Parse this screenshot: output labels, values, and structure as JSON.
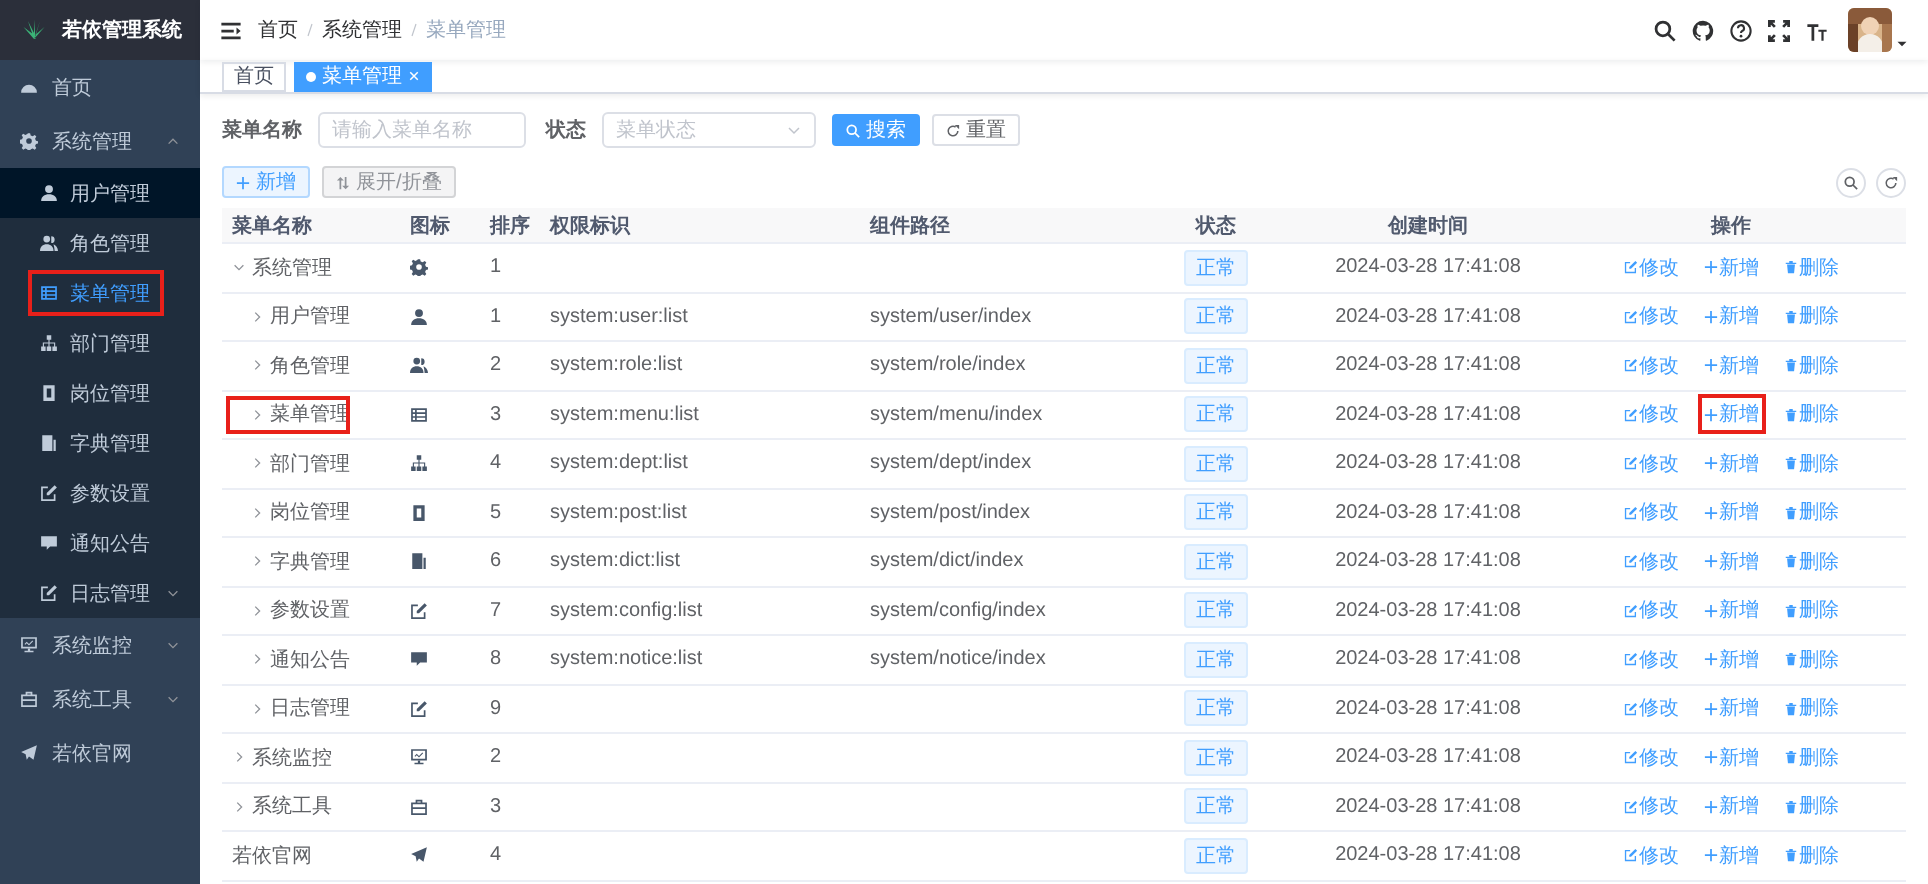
{
  "app": {
    "title": "若依管理系统"
  },
  "sidebar": {
    "items": [
      {
        "label": "首页",
        "kind": "item",
        "selected": false
      },
      {
        "label": "系统管理",
        "kind": "group",
        "selected": false,
        "expanded": true,
        "children": [
          {
            "label": "用户管理",
            "kind": "item",
            "selected": false,
            "hovered": true
          },
          {
            "label": "角色管理",
            "kind": "item",
            "selected": false
          },
          {
            "label": "菜单管理",
            "kind": "item",
            "selected": true,
            "highlighted": true
          },
          {
            "label": "部门管理",
            "kind": "item",
            "selected": false
          },
          {
            "label": "岗位管理",
            "kind": "item",
            "selected": false
          },
          {
            "label": "字典管理",
            "kind": "item",
            "selected": false
          },
          {
            "label": "参数设置",
            "kind": "item",
            "selected": false
          },
          {
            "label": "通知公告",
            "kind": "item",
            "selected": false
          },
          {
            "label": "日志管理",
            "kind": "group",
            "selected": false,
            "expanded": false
          }
        ]
      },
      {
        "label": "系统监控",
        "kind": "group",
        "selected": false,
        "expanded": false
      },
      {
        "label": "系统工具",
        "kind": "group",
        "selected": false,
        "expanded": false
      },
      {
        "label": "若依官网",
        "kind": "item",
        "selected": false
      }
    ]
  },
  "navbar": {
    "breadcrumb": [
      "首页",
      "系统管理",
      "菜单管理"
    ]
  },
  "tags": [
    {
      "label": "首页",
      "selected": false
    },
    {
      "label": "菜单管理",
      "selected": true
    }
  ],
  "search": {
    "fields": [
      {
        "label": "菜单名称",
        "kind": "input",
        "placeholder": "请输入菜单名称"
      },
      {
        "label": "状态",
        "kind": "select",
        "placeholder": "菜单状态"
      }
    ],
    "buttons": [
      {
        "label": "搜索",
        "kind": "primary"
      },
      {
        "label": "重置",
        "kind": "default"
      }
    ]
  },
  "toolbar": {
    "buttons": [
      {
        "label": "新增",
        "kind": "plain"
      },
      {
        "label": "展开/折叠",
        "kind": "info"
      }
    ]
  },
  "table": {
    "columns": [
      "菜单名称",
      "图标",
      "排序",
      "权限标识",
      "组件路径",
      "状态",
      "创建时间",
      "操作"
    ],
    "rows": [
      {
        "name": "系统管理",
        "kind": "dir",
        "expanded": true,
        "sort": "1",
        "status": "正常",
        "created": "2024-03-28 17:41:08",
        "actions": [
          {
            "label": "修改",
            "highlighted": false
          },
          {
            "label": "新增",
            "highlighted": false
          },
          {
            "label": "删除",
            "highlighted": false
          }
        ],
        "children": [
          {
            "name": "用户管理",
            "kind": "dir",
            "expanded": false,
            "sort": "1",
            "perms": "system:user:list",
            "component": "system/user/index",
            "status": "正常",
            "created": "2024-03-28 17:41:08",
            "actions": [
              {
                "label": "修改",
                "highlighted": false
              },
              {
                "label": "新增",
                "highlighted": false
              },
              {
                "label": "删除",
                "highlighted": false
              }
            ]
          },
          {
            "name": "角色管理",
            "kind": "dir",
            "expanded": false,
            "sort": "2",
            "perms": "system:role:list",
            "component": "system/role/index",
            "status": "正常",
            "created": "2024-03-28 17:41:08",
            "actions": [
              {
                "label": "修改",
                "highlighted": false
              },
              {
                "label": "新增",
                "highlighted": false
              },
              {
                "label": "删除",
                "highlighted": false
              }
            ]
          },
          {
            "name": "菜单管理",
            "kind": "dir",
            "expanded": false,
            "highlighted": true,
            "sort": "3",
            "perms": "system:menu:list",
            "component": "system/menu/index",
            "status": "正常",
            "created": "2024-03-28 17:41:08",
            "actions": [
              {
                "label": "修改",
                "highlighted": false
              },
              {
                "label": "新增",
                "highlighted": true
              },
              {
                "label": "删除",
                "highlighted": false
              }
            ]
          },
          {
            "name": "部门管理",
            "kind": "dir",
            "expanded": false,
            "sort": "4",
            "perms": "system:dept:list",
            "component": "system/dept/index",
            "status": "正常",
            "created": "2024-03-28 17:41:08",
            "actions": [
              {
                "label": "修改",
                "highlighted": false
              },
              {
                "label": "新增",
                "highlighted": false
              },
              {
                "label": "删除",
                "highlighted": false
              }
            ]
          },
          {
            "name": "岗位管理",
            "kind": "dir",
            "expanded": false,
            "sort": "5",
            "perms": "system:post:list",
            "component": "system/post/index",
            "status": "正常",
            "created": "2024-03-28 17:41:08",
            "actions": [
              {
                "label": "修改",
                "highlighted": false
              },
              {
                "label": "新增",
                "highlighted": false
              },
              {
                "label": "删除",
                "highlighted": false
              }
            ]
          },
          {
            "name": "字典管理",
            "kind": "dir",
            "expanded": false,
            "sort": "6",
            "perms": "system:dict:list",
            "component": "system/dict/index",
            "status": "正常",
            "created": "2024-03-28 17:41:08",
            "actions": [
              {
                "label": "修改",
                "highlighted": false
              },
              {
                "label": "新增",
                "highlighted": false
              },
              {
                "label": "删除",
                "highlighted": false
              }
            ]
          },
          {
            "name": "参数设置",
            "kind": "dir",
            "expanded": false,
            "sort": "7",
            "perms": "system:config:list",
            "component": "system/config/index",
            "status": "正常",
            "created": "2024-03-28 17:41:08",
            "actions": [
              {
                "label": "修改",
                "highlighted": false
              },
              {
                "label": "新增",
                "highlighted": false
              },
              {
                "label": "删除",
                "highlighted": false
              }
            ]
          },
          {
            "name": "通知公告",
            "kind": "dir",
            "expanded": false,
            "sort": "8",
            "perms": "system:notice:list",
            "component": "system/notice/index",
            "status": "正常",
            "created": "2024-03-28 17:41:08",
            "actions": [
              {
                "label": "修改",
                "highlighted": false
              },
              {
                "label": "新增",
                "highlighted": false
              },
              {
                "label": "删除",
                "highlighted": false
              }
            ]
          },
          {
            "name": "日志管理",
            "kind": "dir",
            "expanded": false,
            "sort": "9",
            "status": "正常",
            "created": "2024-03-28 17:41:08",
            "actions": [
              {
                "label": "修改",
                "highlighted": false
              },
              {
                "label": "新增",
                "highlighted": false
              },
              {
                "label": "删除",
                "highlighted": false
              }
            ]
          }
        ]
      },
      {
        "name": "系统监控",
        "kind": "dir",
        "expanded": false,
        "sort": "2",
        "status": "正常",
        "created": "2024-03-28 17:41:08",
        "actions": [
          {
            "label": "修改",
            "highlighted": false
          },
          {
            "label": "新增",
            "highlighted": false
          },
          {
            "label": "删除",
            "highlighted": false
          }
        ]
      },
      {
        "name": "系统工具",
        "kind": "dir",
        "expanded": false,
        "sort": "3",
        "status": "正常",
        "created": "2024-03-28 17:41:08",
        "actions": [
          {
            "label": "修改",
            "highlighted": false
          },
          {
            "label": "新增",
            "highlighted": false
          },
          {
            "label": "删除",
            "highlighted": false
          }
        ]
      },
      {
        "name": "若依官网",
        "kind": "link",
        "sort": "4",
        "status": "正常",
        "created": "2024-03-28 17:41:08",
        "actions": [
          {
            "label": "修改",
            "highlighted": false
          },
          {
            "label": "新增",
            "highlighted": false
          },
          {
            "label": "删除",
            "highlighted": false
          }
        ]
      }
    ]
  }
}
